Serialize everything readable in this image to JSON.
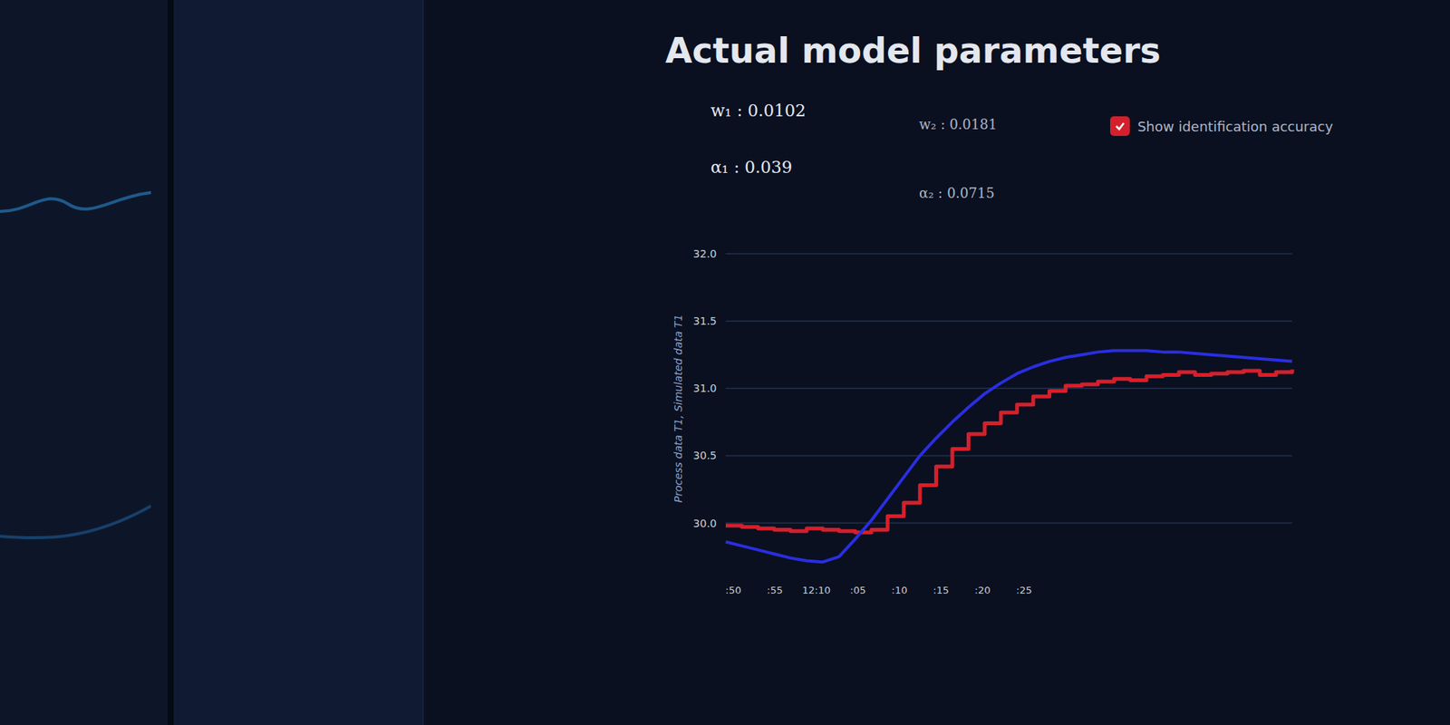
{
  "title": "Actual model parameters",
  "parameters": [
    {
      "text": "w₁ : 0.0102",
      "column": 1
    },
    {
      "text": "α₁ : 0.039",
      "column": 1
    },
    {
      "text": "w₂ : 0.0181",
      "column": 2
    },
    {
      "text": "α₂ : 0.0715",
      "column": 2
    }
  ],
  "checkbox": {
    "label": "Show identification accuracy",
    "checked": true
  },
  "chart": {
    "y_axis_label": "Process data T1, Simulated data T1",
    "y_ticks": [
      "32.0",
      "31.5",
      "31.0",
      "30.5",
      "30.0"
    ],
    "x_ticks": [
      ":50",
      ":55",
      "12:10",
      ":05",
      ":10",
      ":15",
      ":20",
      ":25"
    ],
    "series": [
      {
        "name": "process",
        "color": "#d4202c",
        "kind": "step",
        "values": [
          29.98,
          29.97,
          29.96,
          29.95,
          29.94,
          29.96,
          29.95,
          29.94,
          29.93,
          29.95,
          30.05,
          30.15,
          30.28,
          30.42,
          30.55,
          30.66,
          30.74,
          30.82,
          30.88,
          30.94,
          30.98,
          31.02,
          31.03,
          31.05,
          31.07,
          31.06,
          31.09,
          31.1,
          31.12,
          31.1,
          31.11,
          31.12,
          31.13,
          31.1,
          31.12,
          31.14
        ]
      },
      {
        "name": "simulated",
        "color": "#2a2ee0",
        "kind": "line",
        "values": [
          29.86,
          29.83,
          29.8,
          29.77,
          29.74,
          29.72,
          29.71,
          29.75,
          29.88,
          30.02,
          30.18,
          30.34,
          30.5,
          30.63,
          30.75,
          30.86,
          30.96,
          31.04,
          31.11,
          31.16,
          31.2,
          31.23,
          31.25,
          31.27,
          31.28,
          31.28,
          31.28,
          31.27,
          31.27,
          31.26,
          31.25,
          31.24,
          31.23,
          31.22,
          31.21,
          31.2
        ]
      }
    ]
  }
}
